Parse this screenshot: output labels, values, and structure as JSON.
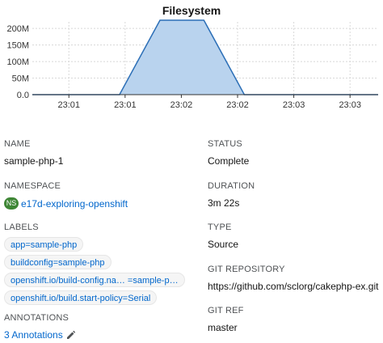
{
  "chart_data": {
    "type": "area",
    "title": "Filesystem",
    "xlabel": "",
    "ylabel": "",
    "y_ticks": [
      "0.0",
      "50M",
      "100M",
      "150M",
      "200M"
    ],
    "y_tick_values": [
      0,
      50,
      100,
      150,
      200
    ],
    "ylim": [
      0,
      220
    ],
    "x_ticks": [
      "23:01",
      "23:01",
      "23:02",
      "23:02",
      "23:03",
      "23:03"
    ],
    "x_tick_positions": [
      1,
      2,
      3,
      4,
      5,
      6
    ],
    "xlim": [
      0.35,
      6.5
    ],
    "grid": true,
    "series": [
      {
        "x": [
          0.35,
          1.9,
          2.62,
          3.4,
          4.12,
          6.5
        ],
        "y": [
          0,
          0,
          225,
          225,
          0,
          0
        ]
      }
    ],
    "colors": {
      "line": "#2c6fb7",
      "fill": "#b9d3ee"
    }
  },
  "details": {
    "name": {
      "label": "NAME",
      "value": "sample-php-1"
    },
    "namespace": {
      "label": "NAMESPACE",
      "badge": "NS",
      "value": "e17d-exploring-openshift"
    },
    "labels": {
      "label": "LABELS",
      "chips": [
        "app=sample-php",
        "buildconfig=sample-php",
        "openshift.io/build-config.na… =sample-p…",
        "openshift.io/build.start-policy=Serial"
      ]
    },
    "annotations": {
      "label": "ANNOTATIONS",
      "value": "3 Annotations"
    },
    "status": {
      "label": "STATUS",
      "value": "Complete"
    },
    "duration": {
      "label": "DURATION",
      "value": "3m 22s"
    },
    "type": {
      "label": "TYPE",
      "value": "Source"
    },
    "git_repository": {
      "label": "GIT REPOSITORY",
      "value": "https://github.com/sclorg/cakephp-ex.git"
    },
    "git_ref": {
      "label": "GIT REF",
      "value": "master"
    }
  }
}
